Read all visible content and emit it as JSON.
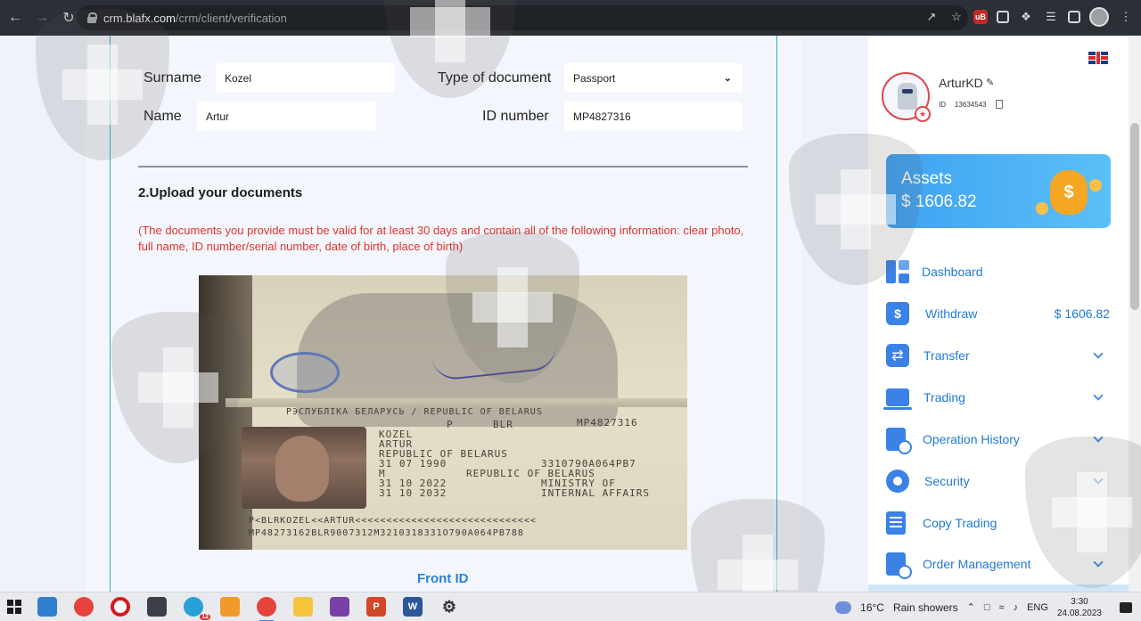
{
  "browser": {
    "url_host": "crm.blafx.com",
    "url_path": "/crm/client/verification",
    "ext_badge": "uB"
  },
  "form": {
    "surname_label": "Surname",
    "surname_value": "Kozel",
    "name_label": "Name",
    "name_value": "Artur",
    "doc_type_label": "Type of document",
    "doc_type_value": "Passport",
    "id_number_label": "ID number",
    "id_number_value": "MP4827316"
  },
  "upload": {
    "title": "2.Upload your documents",
    "notice": "(The documents you provide must be valid for at least 30 days and contain all of the following information: clear photo, full name, ID number/serial number, date of birth, place of birth)",
    "front_label": "Front ID",
    "passport_lines": {
      "header": "РЭСПУБЛІКА БЕЛАРУСЬ / REPUBLIC OF BELARUS",
      "type_code": "P",
      "country": "BLR",
      "number": "MP4827316",
      "surname": "KOZEL",
      "given": "ARTUR",
      "nationality": "REPUBLIC OF BELARUS",
      "dob": "31 07 1990",
      "personal_no": "3310790A064PB7",
      "sex": "M",
      "place": "REPUBLIC OF BELARUS",
      "issued": "31 10 2022",
      "authority": "MINISTRY OF",
      "expiry": "31 10 2032",
      "authority2": "INTERNAL AFFAIRS",
      "mrz1": "P<BLRKOZEL<<ARTUR<<<<<<<<<<<<<<<<<<<<<<<<<<<<<",
      "mrz2": "MP48273162BLR9007312M3210318331O790A064PB788"
    }
  },
  "sidebar": {
    "username": "ArturKD",
    "id_label": "ID",
    "id_value": "13634543",
    "assets_title": "Assets",
    "assets_value": "$ 1606.82",
    "items": [
      {
        "label": "Dashboard"
      },
      {
        "label": "Withdraw",
        "amount": "$ 1606.82"
      },
      {
        "label": "Transfer"
      },
      {
        "label": "Trading"
      },
      {
        "label": "Operation History"
      },
      {
        "label": "Security"
      },
      {
        "label": "Copy Trading"
      },
      {
        "label": "Order Management"
      }
    ]
  },
  "taskbar": {
    "weather_temp": "16°C",
    "weather_desc": "Rain showers",
    "lang": "ENG",
    "time": "3:30",
    "date": "24.08.2023",
    "telegram_badge": "12"
  },
  "colors": {
    "accent_blue": "#1f7ad6",
    "warning_red": "#e1342c",
    "panel_border": "#27b3c4"
  }
}
